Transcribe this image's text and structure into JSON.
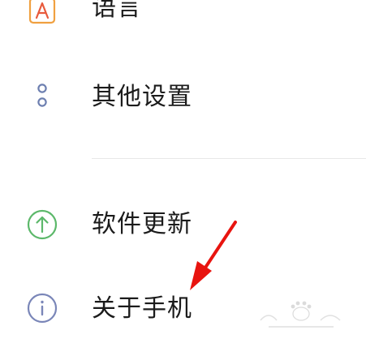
{
  "settings": {
    "items": [
      {
        "id": "language",
        "label": "语言",
        "icon": "language-icon",
        "icon_color": "#f0a040"
      },
      {
        "id": "other",
        "label": "其他设置",
        "icon": "more-dots-icon",
        "icon_color": "#6d7fb0"
      },
      {
        "id": "update",
        "label": "软件更新",
        "icon": "arrow-up-circle-icon",
        "icon_color": "#5cb86a"
      },
      {
        "id": "about",
        "label": "关于手机",
        "icon": "info-circle-icon",
        "icon_color": "#7a86b8"
      }
    ]
  },
  "annotation": {
    "arrow_color": "#e8140f",
    "arrow": "red-arrow-icon"
  },
  "colors": {
    "background": "#ffffff",
    "divider": "#e8e8e8",
    "text": "#1b1b1b"
  }
}
